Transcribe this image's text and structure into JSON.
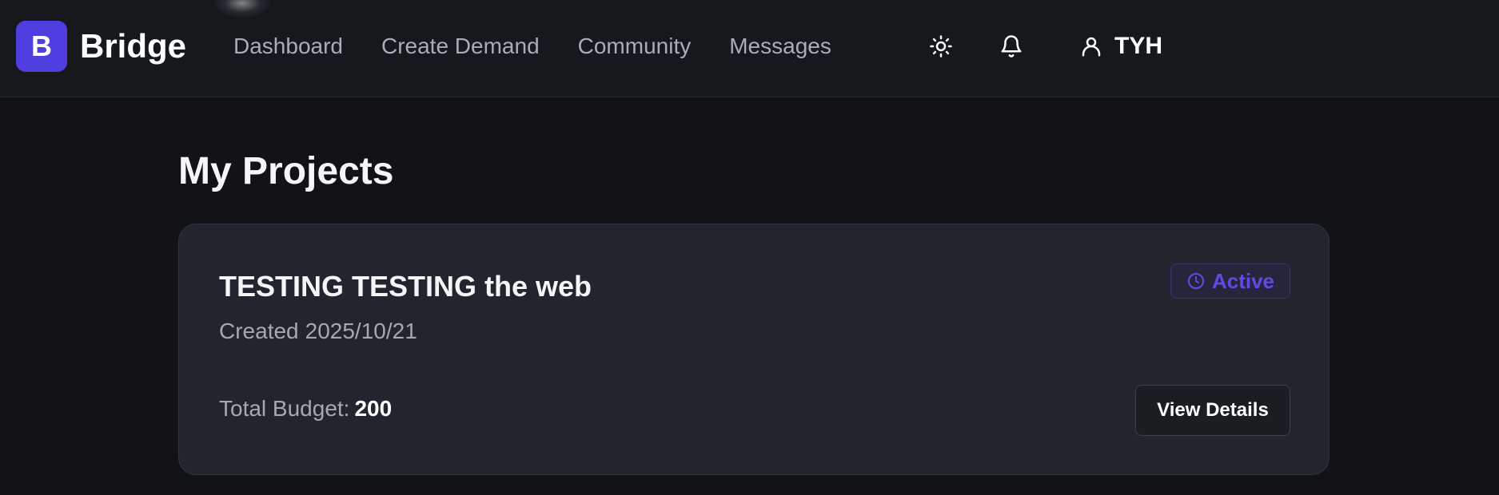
{
  "header": {
    "logo_letter": "B",
    "app_name": "Bridge",
    "nav": [
      {
        "label": "Dashboard"
      },
      {
        "label": "Create Demand"
      },
      {
        "label": "Community"
      },
      {
        "label": "Messages"
      }
    ],
    "icons": {
      "theme": "sun-icon",
      "notifications": "bell-icon",
      "user": "user-icon"
    },
    "user_name": "TYH"
  },
  "main": {
    "title": "My Projects",
    "projects": [
      {
        "title": "TESTING TESTING the web",
        "created_label": "Created",
        "created_date": "2025/10/21",
        "status": "Active",
        "status_icon": "clock-icon",
        "budget_label": "Total Budget:",
        "budget_value": "200",
        "action_label": "View Details"
      }
    ]
  },
  "colors": {
    "background": "#111317",
    "header_background": "#15181d",
    "card_background": "#22252d",
    "brand": "#4f3fe0",
    "status_active": "#5b4ce6",
    "nav_text": "#a8adb7"
  }
}
